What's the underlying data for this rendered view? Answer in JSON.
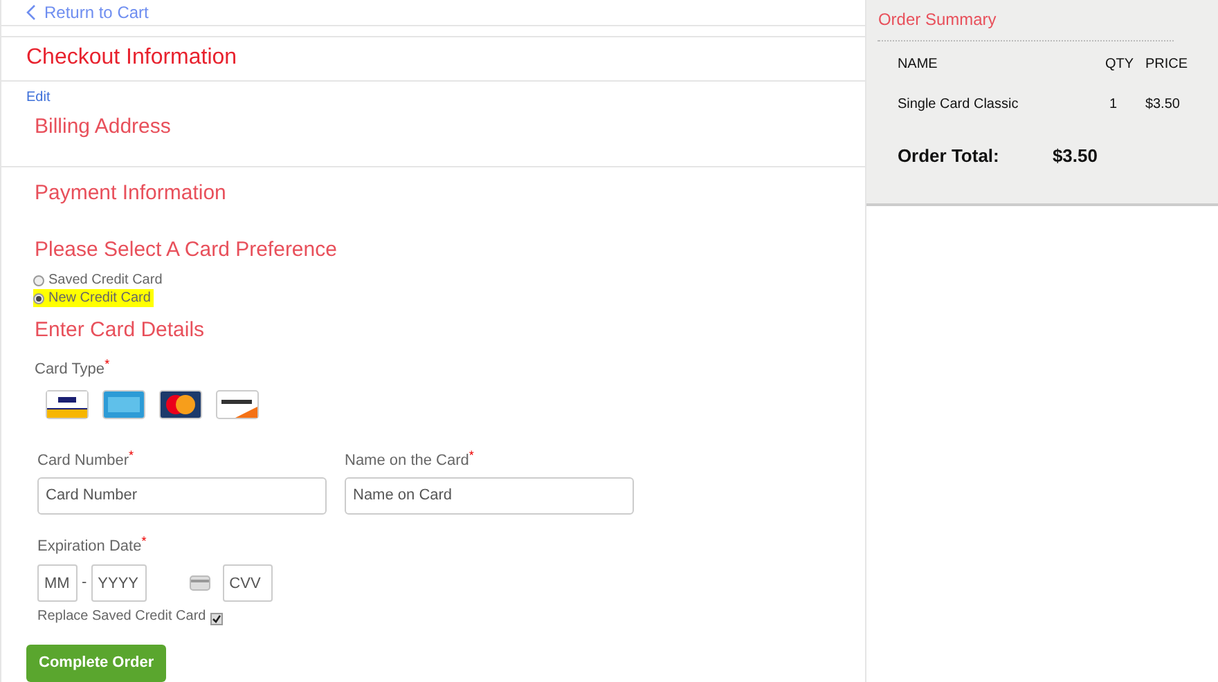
{
  "back_link": "Return to Cart",
  "title": "Checkout Information",
  "edit_link": "Edit",
  "billing_heading": "Billing Address",
  "payment_heading": "Payment Information",
  "preference_heading": "Please Select A Card Preference",
  "card_options": [
    {
      "label": "Saved Credit Card",
      "selected": false
    },
    {
      "label": "New Credit Card",
      "selected": true
    }
  ],
  "details_heading": "Enter Card Details",
  "card_type": {
    "label": "Card Type",
    "required_mark": "*"
  },
  "card_logos": [
    {
      "kind": "visa"
    },
    {
      "kind": "amex"
    },
    {
      "kind": "mastercard"
    },
    {
      "kind": "discover"
    }
  ],
  "card_number": {
    "label": "Card Number",
    "required_mark": "*",
    "placeholder": "Card Number"
  },
  "card_name": {
    "label": "Name on the Card",
    "required_mark": "*",
    "placeholder": "Name on Card"
  },
  "expiration": {
    "label": "Expiration Date",
    "required_mark": "*",
    "month_placeholder": "MM",
    "separator": "-",
    "year_placeholder": "YYYY",
    "cvv_placeholder": "CVV"
  },
  "replace_saved": {
    "label": "Replace Saved Credit Card",
    "checked": true
  },
  "submit_button": "Complete Order",
  "summary": {
    "title": "Order Summary",
    "columns": [
      "NAME",
      "QTY",
      "PRICE"
    ],
    "rows": [
      {
        "name": "Single Card Classic",
        "qty": "1",
        "price": "$3.50"
      }
    ],
    "total_label": "Order Total:",
    "total_value": "$3.50"
  }
}
